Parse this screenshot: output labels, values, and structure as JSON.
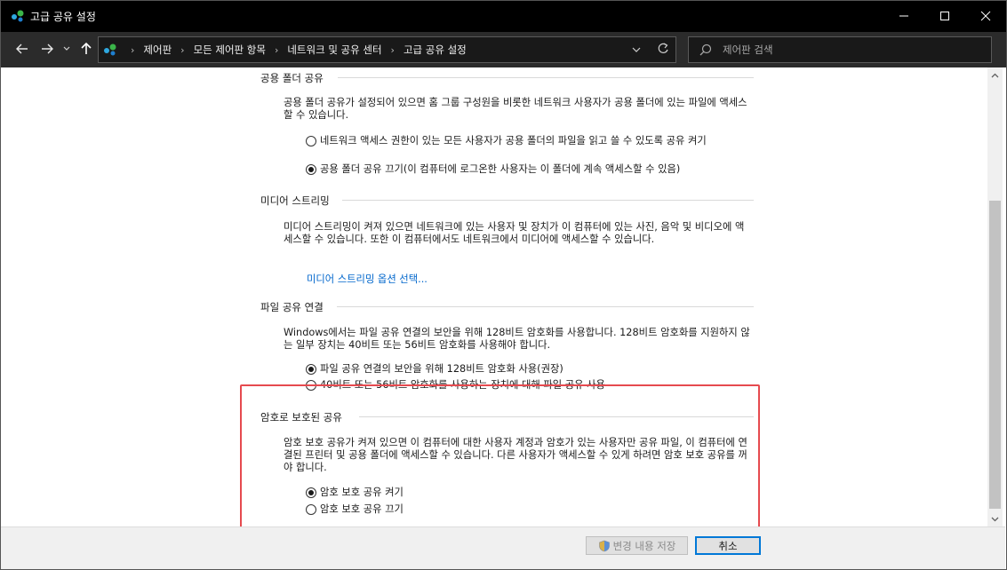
{
  "window": {
    "title": "고급 공유 설정"
  },
  "address": {
    "crumbs": [
      "제어판",
      "모든 제어판 항목",
      "네트워크 및 공유 센터",
      "고급 공유 설정"
    ]
  },
  "search": {
    "placeholder": "제어판 검색"
  },
  "sections": {
    "public_folder": {
      "title": "공용 폴더 공유",
      "desc": "공용 폴더 공유가 설정되어 있으면 홈 그룹 구성원을 비롯한 네트워크 사용자가 공용 폴더에 있는 파일에 액세스할 수 있습니다.",
      "opt_on": "네트워크 액세스 권한이 있는 모든 사용자가 공용 폴더의 파일을 읽고 쓸 수 있도록 공유 켜기",
      "opt_off": "공용 폴더 공유 끄기(이 컴퓨터에 로그온한 사용자는 이 폴더에 계속 액세스할 수 있음)"
    },
    "media_streaming": {
      "title": "미디어 스트리밍",
      "desc": "미디어 스트리밍이 켜져 있으면 네트워크에 있는 사용자 및 장치가 이 컴퓨터에 있는 사진, 음악 및 비디오에 액세스할 수 있습니다. 또한 이 컴퓨터에서도 네트워크에서 미디어에 액세스할 수 있습니다.",
      "link": "미디어 스트리밍 옵션 선택..."
    },
    "file_sharing": {
      "title": "파일 공유 연결",
      "desc": "Windows에서는 파일 공유 연결의 보안을 위해 128비트 암호화를 사용합니다. 128비트 암호화를 지원하지 않는 일부 장치는 40비트 또는 56비트 암호화를 사용해야 합니다.",
      "opt_128": "파일 공유 연결의 보안을 위해 128비트 암호화 사용(권장)",
      "opt_40": "40비트 또는 56비트 암호화를 사용하는 장치에 대해 파일 공유 사용"
    },
    "password": {
      "title": "암호로 보호된 공유",
      "desc": "암호 보호 공유가 켜져 있으면 이 컴퓨터에 대한 사용자 계정과 암호가 있는 사용자만 공유 파일, 이 컴퓨터에 연결된 프린터 및 공용 폴더에 액세스할 수 있습니다. 다른 사용자가 액세스할 수 있게 하려면 암호 보호 공유를 꺼야 합니다.",
      "opt_on": "암호 보호 공유 켜기",
      "opt_off": "암호 보호 공유 끄기"
    }
  },
  "footer": {
    "save_label": "변경 내용 저장",
    "cancel_label": "취소"
  },
  "colors": {
    "accent": "#0078d7",
    "highlight": "#e64a4f",
    "link": "#0066cc"
  }
}
